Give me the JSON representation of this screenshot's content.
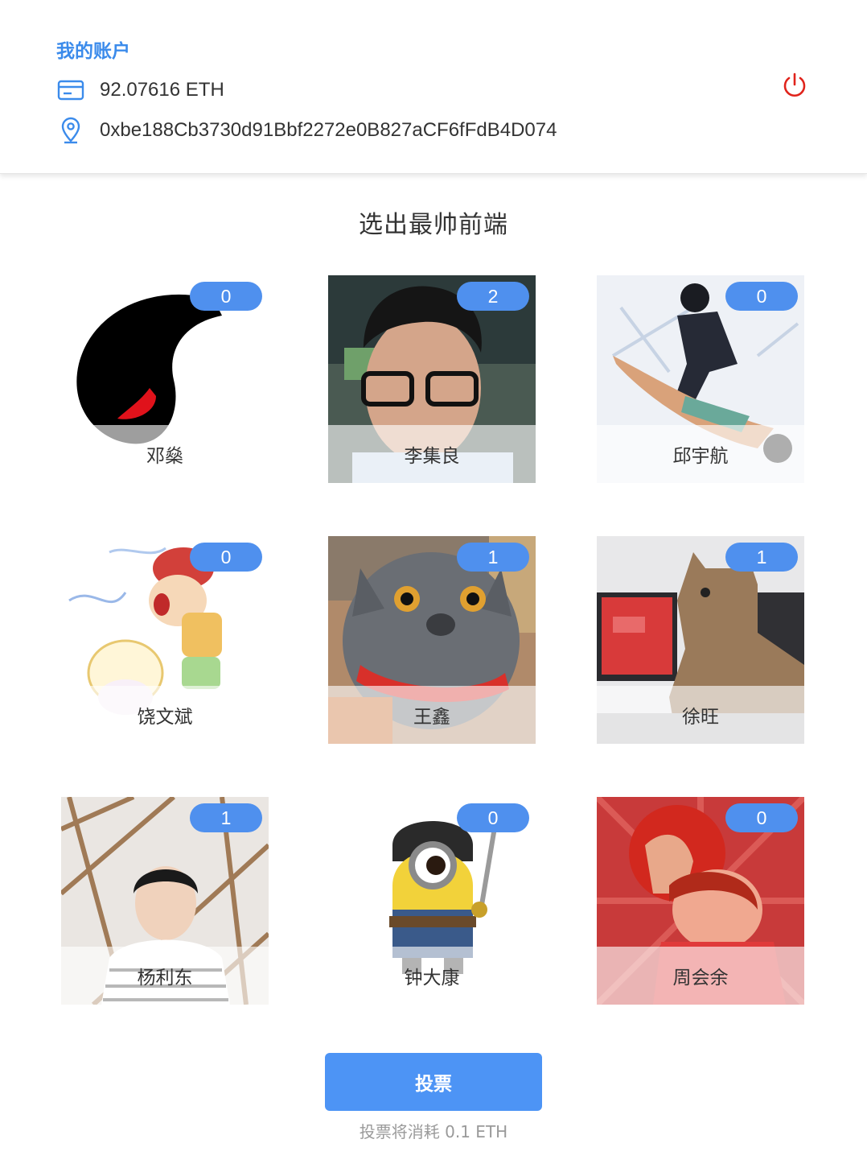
{
  "account": {
    "title": "我的账户",
    "balance": "92.07616 ETH",
    "address": "0xbe188Cb3730d91Bbf2272e0B827aCF6fFdB4D074",
    "accent_color": "#3b8beb",
    "logout_color": "#e0231b",
    "icons": {
      "balance": "credit-card-icon",
      "address": "location-pin-icon",
      "logout": "power-icon"
    }
  },
  "section_title": "选出最帅前端",
  "candidates": [
    {
      "name": "邓燊",
      "votes": "0"
    },
    {
      "name": "李集良",
      "votes": "2"
    },
    {
      "name": "邱宇航",
      "votes": "0"
    },
    {
      "name": "饶文斌",
      "votes": "0"
    },
    {
      "name": "王鑫",
      "votes": "1"
    },
    {
      "name": "徐旺",
      "votes": "1"
    },
    {
      "name": "杨利东",
      "votes": "1"
    },
    {
      "name": "钟大康",
      "votes": "0"
    },
    {
      "name": "周会余",
      "votes": "0"
    }
  ],
  "vote": {
    "button_label": "投票",
    "note": "投票将消耗 0.1 ETH",
    "button_color": "#4d94f5"
  }
}
